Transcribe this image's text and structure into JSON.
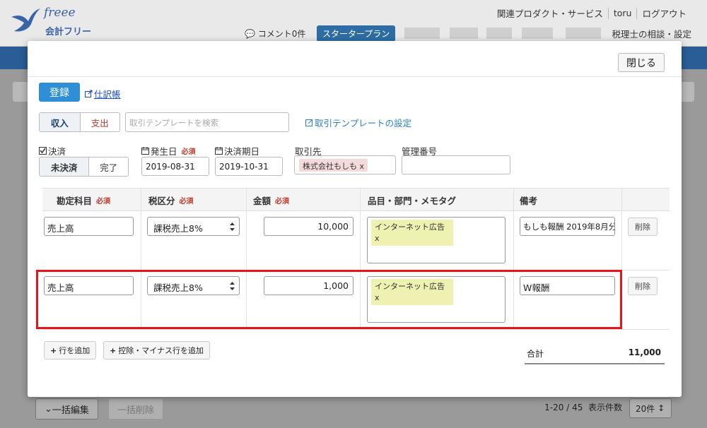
{
  "header": {
    "logo_text": "freee",
    "app_name": "会計フリー",
    "links": [
      "関連プロダクト・サービス",
      "toru",
      "ログアウト"
    ],
    "comment": "コメント0件",
    "plan": "スタータープラン",
    "consult": "税理士の相談・設定"
  },
  "background": {
    "bulk_edit": "一括編集",
    "bulk_delete": "一括削除",
    "paging": "1-20 / 45",
    "per_page_label": "表示件数",
    "per_page_value": "20件"
  },
  "modal": {
    "close": "閉じる",
    "register": "登録",
    "journal_link": "仕訳帳",
    "tabs": {
      "income": "収入",
      "expense": "支出"
    },
    "template_placeholder": "取引テンプレートを検索",
    "template_settings": "取引テンプレートの設定",
    "settlement": {
      "label": "決済",
      "unsettled": "未決済",
      "done": "完了"
    },
    "issue_date": {
      "label": "発生日",
      "required": "必須",
      "value": "2019-08-31"
    },
    "due_date": {
      "label": "決済期日",
      "value": "2019-10-31"
    },
    "partner": {
      "label": "取引先",
      "value": "株式会社もしも",
      "remove": "x"
    },
    "management_no": {
      "label": "管理番号",
      "value": ""
    },
    "table": {
      "headers": {
        "account": "勘定科目",
        "tax": "税区分",
        "amount": "金額",
        "tags": "品目・部門・メモタグ",
        "remarks": "備考",
        "required": "必須"
      },
      "rows": [
        {
          "account": "売上高",
          "tax": "課税売上8%",
          "amount": "10,000",
          "tag": "インターネット広告",
          "tag_remove": "x",
          "remarks": "もしも報酬 2019年8月分",
          "delete": "削除"
        },
        {
          "account": "売上高",
          "tax": "課税売上8%",
          "amount": "1,000",
          "tag": "インターネット広告",
          "tag_remove": "x",
          "remarks": "W報酬",
          "delete": "削除"
        }
      ]
    },
    "add_row": "行を追加",
    "add_minus_row": "控除・マイナス行を追加",
    "total_label": "合計",
    "total_value": "11,000"
  },
  "colors": {
    "primary": "#2e8fd6",
    "highlight": "#e8141c",
    "tag_bg": "#eef1b0",
    "partner_bg": "#f5dada"
  }
}
